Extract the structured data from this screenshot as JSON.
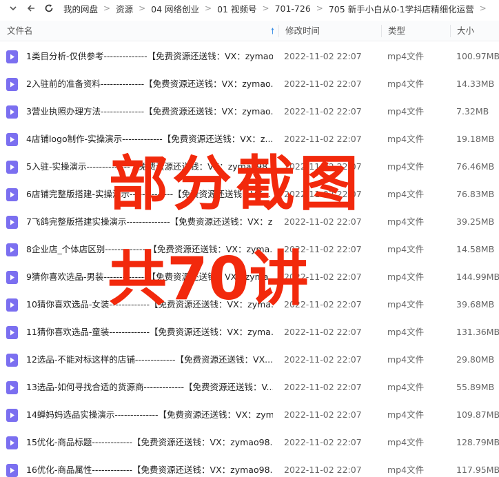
{
  "breadcrumb": [
    "我的网盘",
    "资源",
    "04 网络创业",
    "01 视频号",
    "701-726",
    "705 新手小白从0-1学抖店精细化运营"
  ],
  "columns": {
    "name": "文件名",
    "date": "修改时间",
    "type": "类型",
    "size": "大小"
  },
  "files": [
    {
      "name": "1类目分析-仅供参考--------------【免费资源还送钱：VX：zymao...",
      "date": "2022-11-02 22:07",
      "type": "mp4文件",
      "size": "100.97MB"
    },
    {
      "name": "2入驻前的准备资料--------------【免费资源还送钱：VX：zymao...",
      "date": "2022-11-02 22:07",
      "type": "mp4文件",
      "size": "14.33MB"
    },
    {
      "name": "3营业执照办理方法--------------【免费资源还送钱：VX：zymao...",
      "date": "2022-11-02 22:07",
      "type": "mp4文件",
      "size": "7.32MB"
    },
    {
      "name": "4店铺logo制作-实操演示-------------【免费资源还送钱：VX：z...",
      "date": "2022-11-02 22:07",
      "type": "mp4文件",
      "size": "19.18MB"
    },
    {
      "name": "5入驻-实操演示--------------【免费资源还送钱：VX：zymao98...",
      "date": "2022-11-02 22:07",
      "type": "mp4文件",
      "size": "76.46MB"
    },
    {
      "name": "6店铺完整版搭建-实操演示--------------【免费资源还送钱：VX...",
      "date": "2022-11-02 22:07",
      "type": "mp4文件",
      "size": "76.83MB"
    },
    {
      "name": "7飞鸽完整版搭建实操演示--------------【免费资源还送钱：VX：z...",
      "date": "2022-11-02 22:07",
      "type": "mp4文件",
      "size": "39.25MB"
    },
    {
      "name": "8企业店_个体店区别--------------【免费资源还送钱：VX：zyma...",
      "date": "2022-11-02 22:07",
      "type": "mp4文件",
      "size": "14.58MB"
    },
    {
      "name": "9猜你喜欢选品-男装--------------【免费资源还送钱：VX：zyma...",
      "date": "2022-11-02 22:07",
      "type": "mp4文件",
      "size": "144.99MB"
    },
    {
      "name": "10猜你喜欢选品-女装-------------【免费资源还送钱：VX：zyma...",
      "date": "2022-11-02 22:07",
      "type": "mp4文件",
      "size": "39.68MB"
    },
    {
      "name": "11猜你喜欢选品-童装-------------【免费资源还送钱：VX：zyma...",
      "date": "2022-11-02 22:07",
      "type": "mp4文件",
      "size": "131.36MB"
    },
    {
      "name": "12选品-不能对标这样的店铺-------------【免费资源还送钱：VX...",
      "date": "2022-11-02 22:07",
      "type": "mp4文件",
      "size": "29.80MB"
    },
    {
      "name": "13选品-如何寻找合适的货源商-------------【免费资源还送钱：V...",
      "date": "2022-11-02 22:07",
      "type": "mp4文件",
      "size": "55.89MB"
    },
    {
      "name": "14蝉妈妈选品实操演示--------------【免费资源还送钱：VX：zym...",
      "date": "2022-11-02 22:07",
      "type": "mp4文件",
      "size": "109.87MB"
    },
    {
      "name": "15优化-商品标题-------------【免费资源还送钱：VX：zymao98...",
      "date": "2022-11-02 22:07",
      "type": "mp4文件",
      "size": "128.79MB"
    },
    {
      "name": "16优化-商品属性-------------【免费资源还送钱：VX：zymao98...",
      "date": "2022-11-02 22:07",
      "type": "mp4文件",
      "size": "117.95MB"
    }
  ],
  "overlay": {
    "line1": "部分截图",
    "line2": "共70讲"
  },
  "colors": {
    "accent": "#3a8ee6",
    "file_icon": "#7b6ff0",
    "overlay": "#f2290c"
  }
}
